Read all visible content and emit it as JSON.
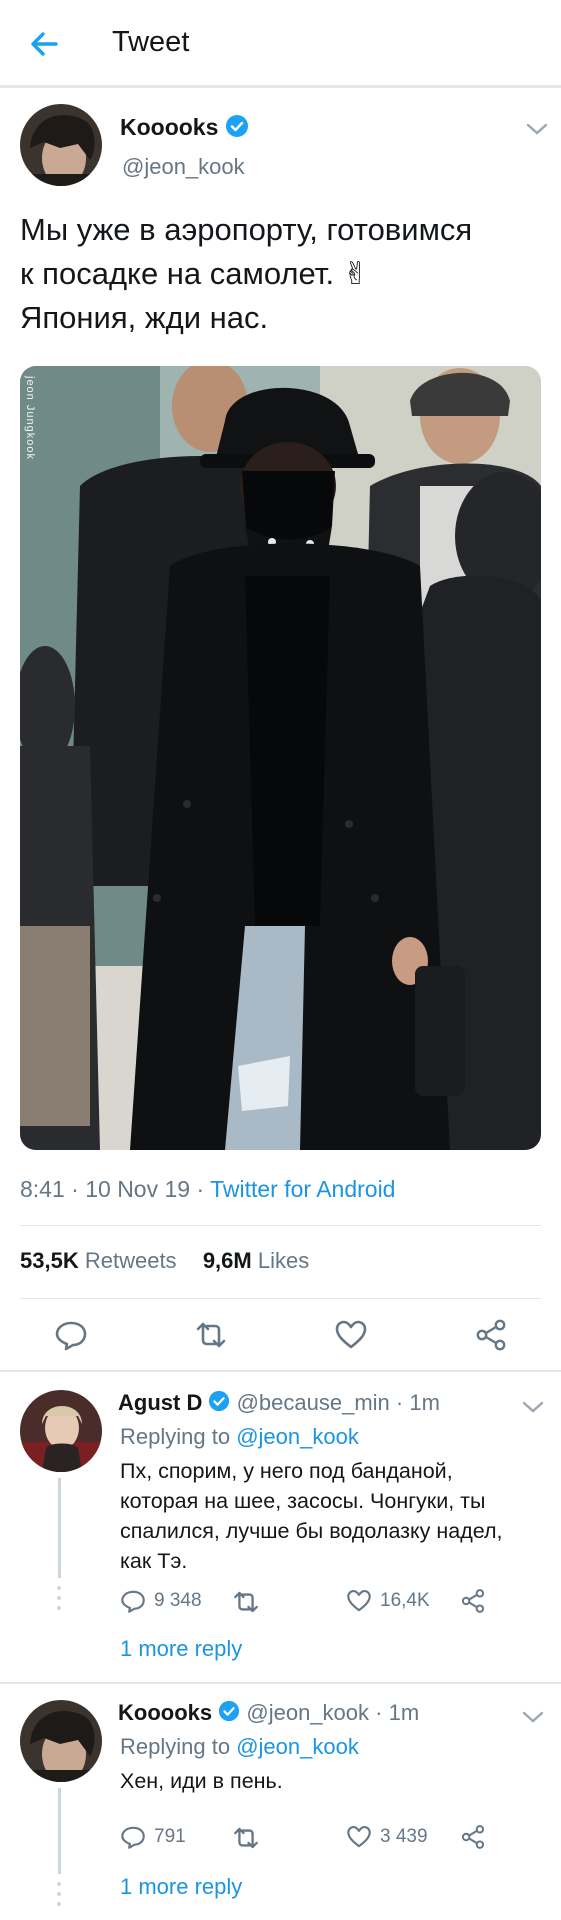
{
  "header": {
    "title": "Tweet"
  },
  "tweet": {
    "author_name": "Kooooks",
    "author_handle": "@jeon_kook",
    "text_line1": "Мы уже в аэропорту, готовимся",
    "text_line2": "к посадке на самолет. ✌",
    "text_line3": "Япония, жди нас.",
    "time": "8:41",
    "date": "10 Nov 19",
    "source": "Twitter for Android",
    "retweets_count": "53,5K",
    "retweets_label": "Retweets",
    "likes_count": "9,6M",
    "likes_label": "Likes",
    "photo_watermark": "jeon Jungkook"
  },
  "replies": [
    {
      "name": "Agust D",
      "handle": "@because_min",
      "age": "1m",
      "replying_prefix": "Replying to",
      "replying_to": "@jeon_kook",
      "text_line1": "Пх, спорим, у него под банданой,",
      "text_line2": "которая на шее, засосы. Чонгуки, ты",
      "text_line3": "спалился, лучше бы водолазку надел,",
      "text_line4": "как Тэ.",
      "replies_count": "9 348",
      "likes_count": "16,4K",
      "more": "1 more reply"
    },
    {
      "name": "Kooooks",
      "handle": "@jeon_kook",
      "age": "1m",
      "replying_prefix": "Replying to",
      "replying_to": "@jeon_kook",
      "text_line1": "Хен, иди в пень.",
      "replies_count": "791",
      "likes_count": "3 439",
      "more": "1 more reply"
    }
  ],
  "colors": {
    "accent": "#1b95e0",
    "verified": "#1da1f2",
    "muted": "#657786",
    "divider": "#e1e8ed"
  }
}
